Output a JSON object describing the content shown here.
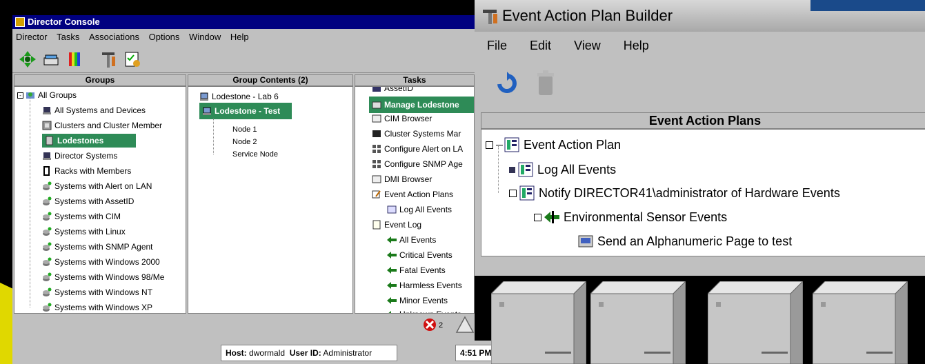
{
  "console": {
    "title": "Director Console",
    "menu": [
      "Director",
      "Tasks",
      "Associations",
      "Options",
      "Window",
      "Help"
    ],
    "panes": {
      "groups_header": "Groups",
      "contents_header": "Group Contents (2)",
      "tasks_header": "Tasks"
    },
    "groups": [
      "All Groups",
      "All Systems and Devices",
      "Clusters and Cluster Member",
      "Lodestones",
      "Director Systems",
      "Racks with Members",
      "Systems with Alert on LAN",
      "Systems with AssetID",
      "Systems with CIM",
      "Systems with Linux",
      "Systems with SNMP Agent",
      "Systems with Windows 2000",
      "Systems with Windows 98/Me",
      "Systems with Windows NT",
      "Systems with Windows XP"
    ],
    "contents": [
      "Lodestone - Lab 6",
      "Lodestone - Test",
      "Node 1",
      "Node 2",
      "Service Node"
    ],
    "tasks": [
      "AssetID",
      "Manage Lodestone",
      "CIM Browser",
      "Cluster Systems Mar",
      "Configure Alert on LA",
      "Configure SNMP Age",
      "DMI Browser",
      "Event Action Plans",
      "Log All Events",
      "Event Log",
      "All Events",
      "Critical Events",
      "Fatal Events",
      "Harmless Events",
      "Minor Events",
      "Unknown Events"
    ],
    "status": {
      "alert_count": "2",
      "host_label": "Host:",
      "host_value": "dwormald",
      "user_label": "User ID:",
      "user_value": "Administrator",
      "time": "4:51 PM"
    }
  },
  "eap_builder": {
    "title": "Event Action Plan Builder",
    "menu": [
      "File",
      "Edit",
      "View",
      "Help"
    ],
    "header": "Event Action Plans",
    "tree": [
      "Event Action Plan",
      "Log All Events",
      "Notify DIRECTOR41\\administrator of Hardware Events",
      "Environmental Sensor Events",
      "Send an Alphanumeric Page to test"
    ]
  },
  "colors": {
    "selection": "#2e8b57",
    "titlebar": "#000080",
    "panel": "#c0c0c0",
    "background": "#000000"
  }
}
